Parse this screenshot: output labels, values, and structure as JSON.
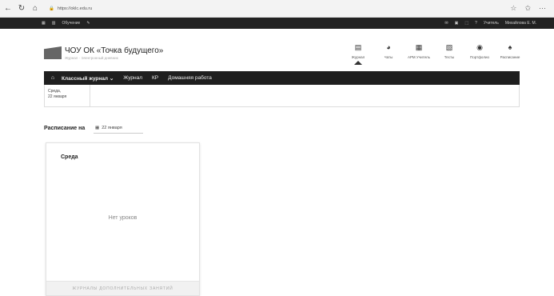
{
  "browser": {
    "url": "https://oklc.edu.ru",
    "icons": [
      "back-icon",
      "refresh-icon",
      "home-icon",
      "lock-icon",
      "star-icon",
      "favorites-icon",
      "menu-icon"
    ]
  },
  "topbar": {
    "left": [
      "Обучение"
    ],
    "right_user": "Учитель",
    "right_name": "Михайлова Е. М."
  },
  "header": {
    "school_name": "ЧОУ ОК «Точка будущего»",
    "school_sub": "Журнал · Электронный дневник"
  },
  "modules": [
    {
      "label": "Журнал",
      "icon": "journal-icon"
    },
    {
      "label": "Чаты",
      "icon": "chat-icon"
    },
    {
      "label": "АРМ Учитель",
      "icon": "workstation-icon"
    },
    {
      "label": "Тесты",
      "icon": "tests-icon"
    },
    {
      "label": "Портфолио",
      "icon": "portfolio-icon"
    },
    {
      "label": "Расписание",
      "icon": "schedule-icon"
    }
  ],
  "mainnav": {
    "class_journal": "Классный журнал",
    "journal": "Журнал",
    "kr": "КР",
    "homework": "Домашняя работа"
  },
  "datebar": {
    "day": "Среда,",
    "date": "22 января"
  },
  "schedule": {
    "label": "Расписание на",
    "date": "22 января"
  },
  "card": {
    "title": "Среда",
    "empty": "Нет уроков",
    "footer": "ЖУРНАЛЫ ДОПОЛНИТЕЛЬНЫХ ЗАНЯТИЙ"
  }
}
